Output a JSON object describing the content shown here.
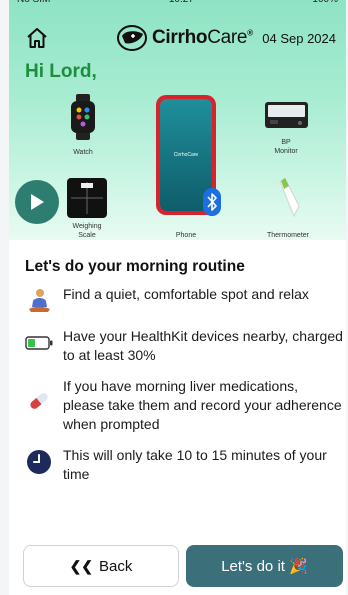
{
  "status": {
    "left": "No SIM",
    "center": "10:27",
    "right": "100%"
  },
  "header": {
    "home_icon": "home-icon",
    "logo": {
      "main": "Cirrho",
      "accent": "Care",
      "reg": "®"
    },
    "date": "04 Sep 2024"
  },
  "greeting": "Hi Lord,",
  "devices": {
    "watch": "Watch",
    "bp_monitor": "BP\nMonitor",
    "scale": "Weighing\nScale",
    "phone": "Phone",
    "thermometer": "Thermometer",
    "phone_app": "CirrhoCare"
  },
  "routine": {
    "heading": "Let's do your morning routine",
    "items": [
      {
        "icon": "meditation-icon",
        "text": "Find a quiet, comfortable spot and relax"
      },
      {
        "icon": "battery-icon",
        "text": "Have your HealthKit devices nearby, charged to at least 30%"
      },
      {
        "icon": "pill-icon",
        "text": "If you have morning liver medications, please take them and record your adherence when prompted"
      },
      {
        "icon": "clock-icon",
        "text": "This will only take 10 to 15 minutes of your time"
      }
    ]
  },
  "buttons": {
    "back": "Back",
    "go": "Let's do it 🎉"
  },
  "colors": {
    "accent": "#1e8e3e",
    "primary_button": "#3b6f7a",
    "play": "#2e7d71"
  }
}
